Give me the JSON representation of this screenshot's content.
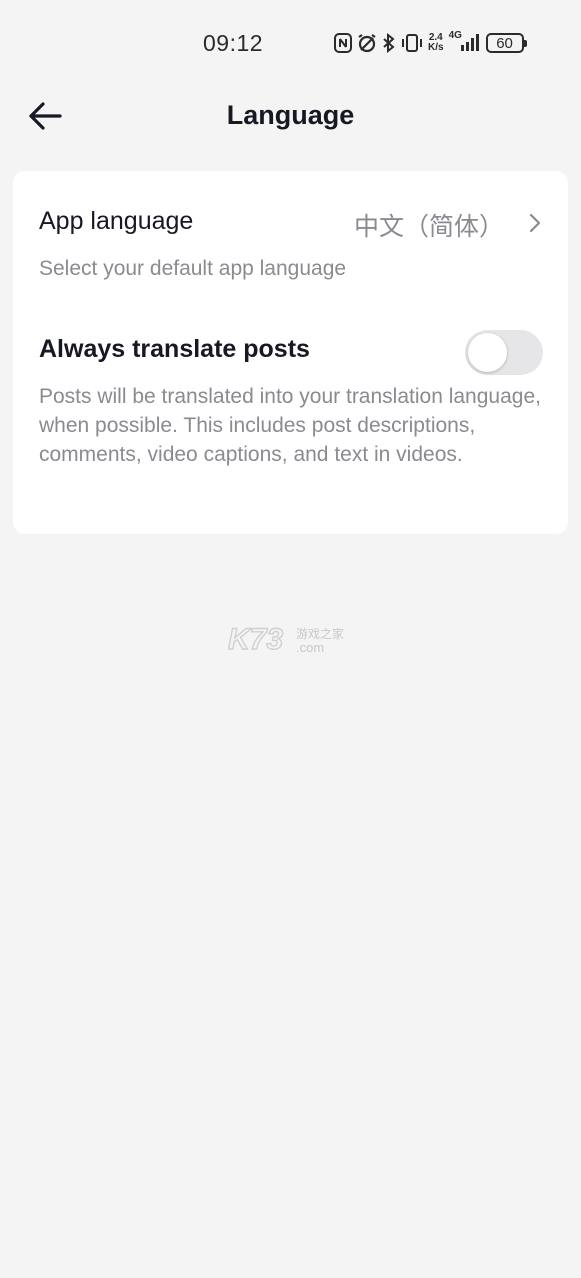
{
  "status_bar": {
    "time": "09:12",
    "speed_value": "2.4",
    "speed_unit": "K/s",
    "network": "4G",
    "battery": "60",
    "icons": [
      "nfc-icon",
      "alarm-icon",
      "bluetooth-icon",
      "vibrate-icon",
      "signal-icon",
      "battery-icon"
    ]
  },
  "header": {
    "title": "Language",
    "back_icon": "arrow-left-icon"
  },
  "settings": {
    "app_language": {
      "title": "App language",
      "value": "中文（简体）",
      "description": "Select your default app language"
    },
    "translate_posts": {
      "title": "Always translate posts",
      "enabled": false,
      "description": "Posts will be translated into your translation language, when possible. This includes post descriptions, comments, video captions, and text in videos."
    }
  },
  "watermark": {
    "brand": "K73",
    "sub_cn": "游戏之家",
    "sub_domain": ".com"
  },
  "colors": {
    "background": "#f4f4f4",
    "card": "#ffffff",
    "primary_text": "#161823",
    "secondary_text": "#8a8b91",
    "toggle_off": "#e6e6e8"
  }
}
